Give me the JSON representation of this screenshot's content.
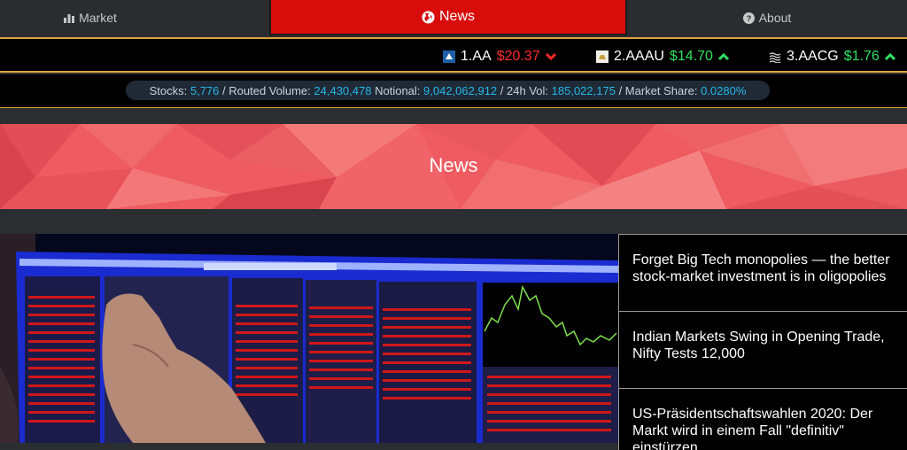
{
  "nav": {
    "market": {
      "label": "Market",
      "icon": "bar-chart-icon"
    },
    "news": {
      "label": "News",
      "icon": "globe-icon"
    },
    "about": {
      "label": "About",
      "icon": "question-circle-icon"
    }
  },
  "ticker": [
    {
      "label": "1.AA",
      "price": "$20.37",
      "direction": "down",
      "color": "#ff2a2a",
      "logo": "alcoa-logo-icon"
    },
    {
      "label": "2.AAAU",
      "price": "$14.70",
      "direction": "up",
      "color": "#30e060",
      "logo": "gold-bar-logo-icon"
    },
    {
      "label": "3.AACG",
      "price": "$1.76",
      "direction": "up",
      "color": "#30e060",
      "logo": "wave-logo-icon"
    }
  ],
  "stats": {
    "stocks_label": "Stocks:",
    "stocks": "5,776",
    "routed_label": "/ Routed Volume:",
    "routed": "24,430,478",
    "notional_label": "Notional:",
    "notional": "9,042,062,912",
    "vol_label": "/ 24h Vol:",
    "vol": "185,022,175",
    "share_label": "/ Market Share:",
    "share": "0.0280%"
  },
  "hero": {
    "title": "News"
  },
  "featured_image": {
    "alt": "Trader pointing at stock screens",
    "icon": "trading-screens-photo"
  },
  "headlines": [
    {
      "title": "Forget Big Tech monopolies — the better stock-market investment is in oligopolies"
    },
    {
      "title": "Indian Markets Swing in Opening Trade, Nifty Tests 12,000"
    },
    {
      "title": "US-Präsidentschaftswahlen 2020: Der Markt wird in einem Fall \"definitiv\" einstürzen"
    }
  ],
  "colors": {
    "accent": "#d90c0c",
    "gold": "#e0a33a",
    "link_blue": "#25b7e9",
    "hero": "#ef5a5e"
  }
}
